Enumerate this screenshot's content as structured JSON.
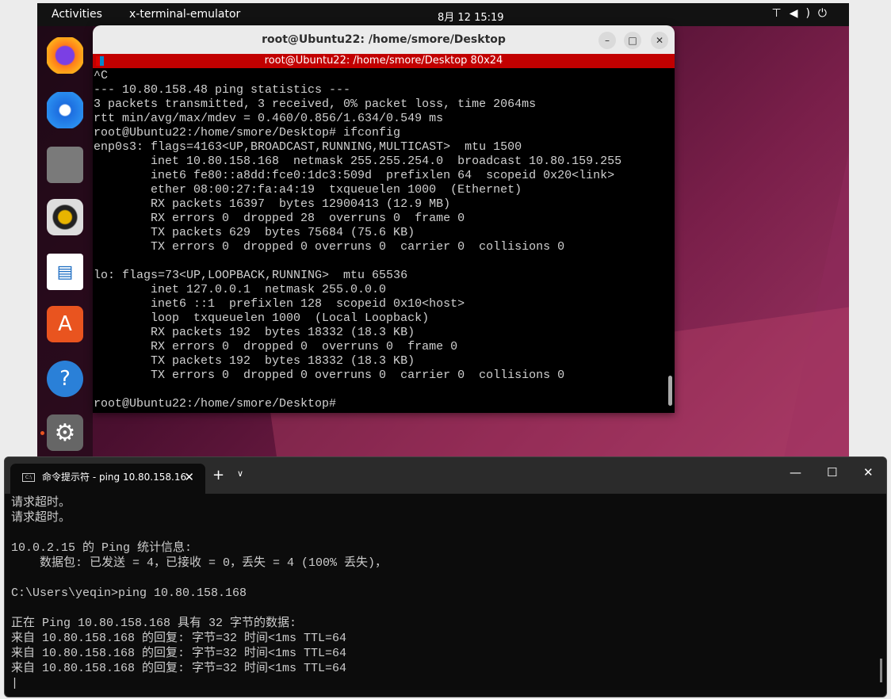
{
  "topbar": {
    "activities": "Activities",
    "app": "x-terminal-emulator",
    "clock": "8月 12 15:19",
    "tray": "⊤◀)⏻"
  },
  "dock": [
    {
      "name": "firefox"
    },
    {
      "name": "thunderbird"
    },
    {
      "name": "files"
    },
    {
      "name": "rhythmbox"
    },
    {
      "name": "libreoffice-writer"
    },
    {
      "name": "app-center"
    },
    {
      "name": "help"
    },
    {
      "name": "settings"
    }
  ],
  "terminal": {
    "title": "root@Ubuntu22: /home/smore/Desktop",
    "xterm_title": "root@Ubuntu22: /home/smore/Desktop 80x24",
    "lines": [
      "^C",
      "--- 10.80.158.48 ping statistics ---",
      "3 packets transmitted, 3 received, 0% packet loss, time 2064ms",
      "rtt min/avg/max/mdev = 0.460/0.856/1.634/0.549 ms",
      "root@Ubuntu22:/home/smore/Desktop# ifconfig",
      "enp0s3: flags=4163<UP,BROADCAST,RUNNING,MULTICAST>  mtu 1500",
      "        inet 10.80.158.168  netmask 255.255.254.0  broadcast 10.80.159.255",
      "        inet6 fe80::a8dd:fce0:1dc3:509d  prefixlen 64  scopeid 0x20<link>",
      "        ether 08:00:27:fa:a4:19  txqueuelen 1000  (Ethernet)",
      "        RX packets 16397  bytes 12900413 (12.9 MB)",
      "        RX errors 0  dropped 28  overruns 0  frame 0",
      "        TX packets 629  bytes 75684 (75.6 KB)",
      "        TX errors 0  dropped 0 overruns 0  carrier 0  collisions 0",
      "",
      "lo: flags=73<UP,LOOPBACK,RUNNING>  mtu 65536",
      "        inet 127.0.0.1  netmask 255.0.0.0",
      "        inet6 ::1  prefixlen 128  scopeid 0x10<host>",
      "        loop  txqueuelen 1000  (Local Loopback)",
      "        RX packets 192  bytes 18332 (18.3 KB)",
      "        RX errors 0  dropped 0  overruns 0  frame 0",
      "        TX packets 192  bytes 18332 (18.3 KB)",
      "        TX errors 0  dropped 0 overruns 0  carrier 0  collisions 0",
      "",
      "root@Ubuntu22:/home/smore/Desktop#"
    ]
  },
  "cmd": {
    "tab_title": "命令提示符 - ping  10.80.158.16",
    "lines": [
      "请求超时。",
      "请求超时。",
      "",
      "10.0.2.15 的 Ping 统计信息:",
      "    数据包: 已发送 = 4，已接收 = 0，丢失 = 4 (100% 丢失)，",
      "",
      "C:\\Users\\yeqin>ping 10.80.158.168",
      "",
      "正在 Ping 10.80.158.168 具有 32 字节的数据:",
      "来自 10.80.158.168 的回复: 字节=32 时间<1ms TTL=64",
      "来自 10.80.158.168 的回复: 字节=32 时间<1ms TTL=64",
      "来自 10.80.158.168 的回复: 字节=32 时间<1ms TTL=64",
      "|"
    ]
  }
}
